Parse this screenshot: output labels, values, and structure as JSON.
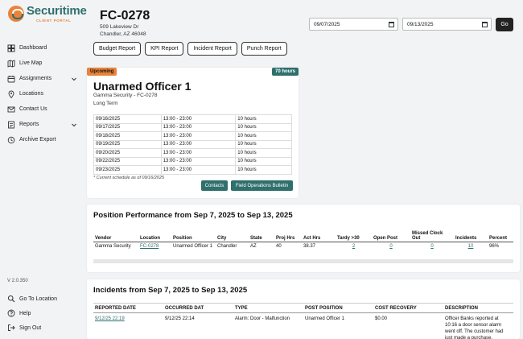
{
  "brand": {
    "name": "Securitime",
    "sub": "CLIENT PORTAL"
  },
  "sidebar": {
    "items": [
      {
        "label": "Dashboard",
        "icon": "dashboard-icon"
      },
      {
        "label": "Live Map",
        "icon": "map-icon"
      },
      {
        "label": "Assignments",
        "icon": "assignments-icon",
        "expandable": true
      },
      {
        "label": "Locations",
        "icon": "location-pin-icon"
      },
      {
        "label": "Contact Us",
        "icon": "mail-icon"
      },
      {
        "label": "Reports",
        "icon": "reports-icon",
        "expandable": true
      },
      {
        "label": "Archive Export",
        "icon": "history-icon"
      }
    ],
    "version": "V 2.0.350",
    "bottom": [
      {
        "label": "Go To Location",
        "icon": "search-icon"
      },
      {
        "label": "Help",
        "icon": "help-icon"
      },
      {
        "label": "Sign Out",
        "icon": "sign-out-icon"
      }
    ]
  },
  "header": {
    "title": "FC-0278",
    "address1": "509 Lakeview Dr",
    "address2": "Chandler, AZ 46048",
    "buttons": [
      "Budget Report",
      "KPI Report",
      "Incident Report",
      "Punch Report"
    ],
    "date_from": "09/07/2025",
    "date_to": "09/13/2025",
    "go": "Go"
  },
  "shift": {
    "status": "Upcoming",
    "hours_badge": "70 hours",
    "title": "Unarmed Officer 1",
    "subtitle": "Gamma Security - FC-0278",
    "term": "Long Term",
    "schedule": [
      [
        "09/16/2025",
        "13:00 - 23:00",
        "10 hours"
      ],
      [
        "09/17/2025",
        "13:00 - 23:00",
        "10 hours"
      ],
      [
        "09/18/2025",
        "13:00 - 23:00",
        "10 hours"
      ],
      [
        "09/19/2025",
        "13:00 - 23:00",
        "10 hours"
      ],
      [
        "09/20/2025",
        "13:00 - 23:00",
        "10 hours"
      ],
      [
        "09/22/2025",
        "13:00 - 23:00",
        "10 hours"
      ],
      [
        "09/23/2025",
        "13:00 - 23:00",
        "10 hours"
      ]
    ],
    "note": "* Current schedule as of 09/16/2025",
    "contacts_btn": "Contacts",
    "bulletin_btn": "Field Operations Bulletin"
  },
  "performance": {
    "title": "Position Performance from Sep 7, 2025 to Sep 13, 2025",
    "headers": [
      "Vendor",
      "Location",
      "Position",
      "City",
      "State",
      "Proj Hrs",
      "Act Hrs",
      "Tardy >30",
      "Open Post",
      "Missed Clock Out",
      "Incidents",
      "Percent"
    ],
    "row": [
      "Gamma Security",
      "FC-0278",
      "Unarmed Officer 1",
      "Chandler",
      "AZ",
      "40",
      "38.37",
      "2",
      "0",
      "0",
      "10",
      "96%"
    ]
  },
  "incidents": {
    "title": "Incidents from Sep 7, 2025 to Sep 13, 2025",
    "headers": [
      "REPORTED DATE",
      "OCCURRED DAT",
      "TYPE",
      "POST POSITION",
      "COST RECOVERY",
      "DESCRIPTION"
    ],
    "row": [
      "9/12/25 22:19",
      "9/12/25 22:14",
      "Alarm: Door - Malfunction",
      "Unarmed Officer 1",
      "$0.00",
      "Officer Banks reported at 10:16 a door sensor alarm went off. The customer had just made a purchase."
    ]
  },
  "colors": {
    "teal": "#2f6f6c",
    "orange": "#e8833a"
  }
}
